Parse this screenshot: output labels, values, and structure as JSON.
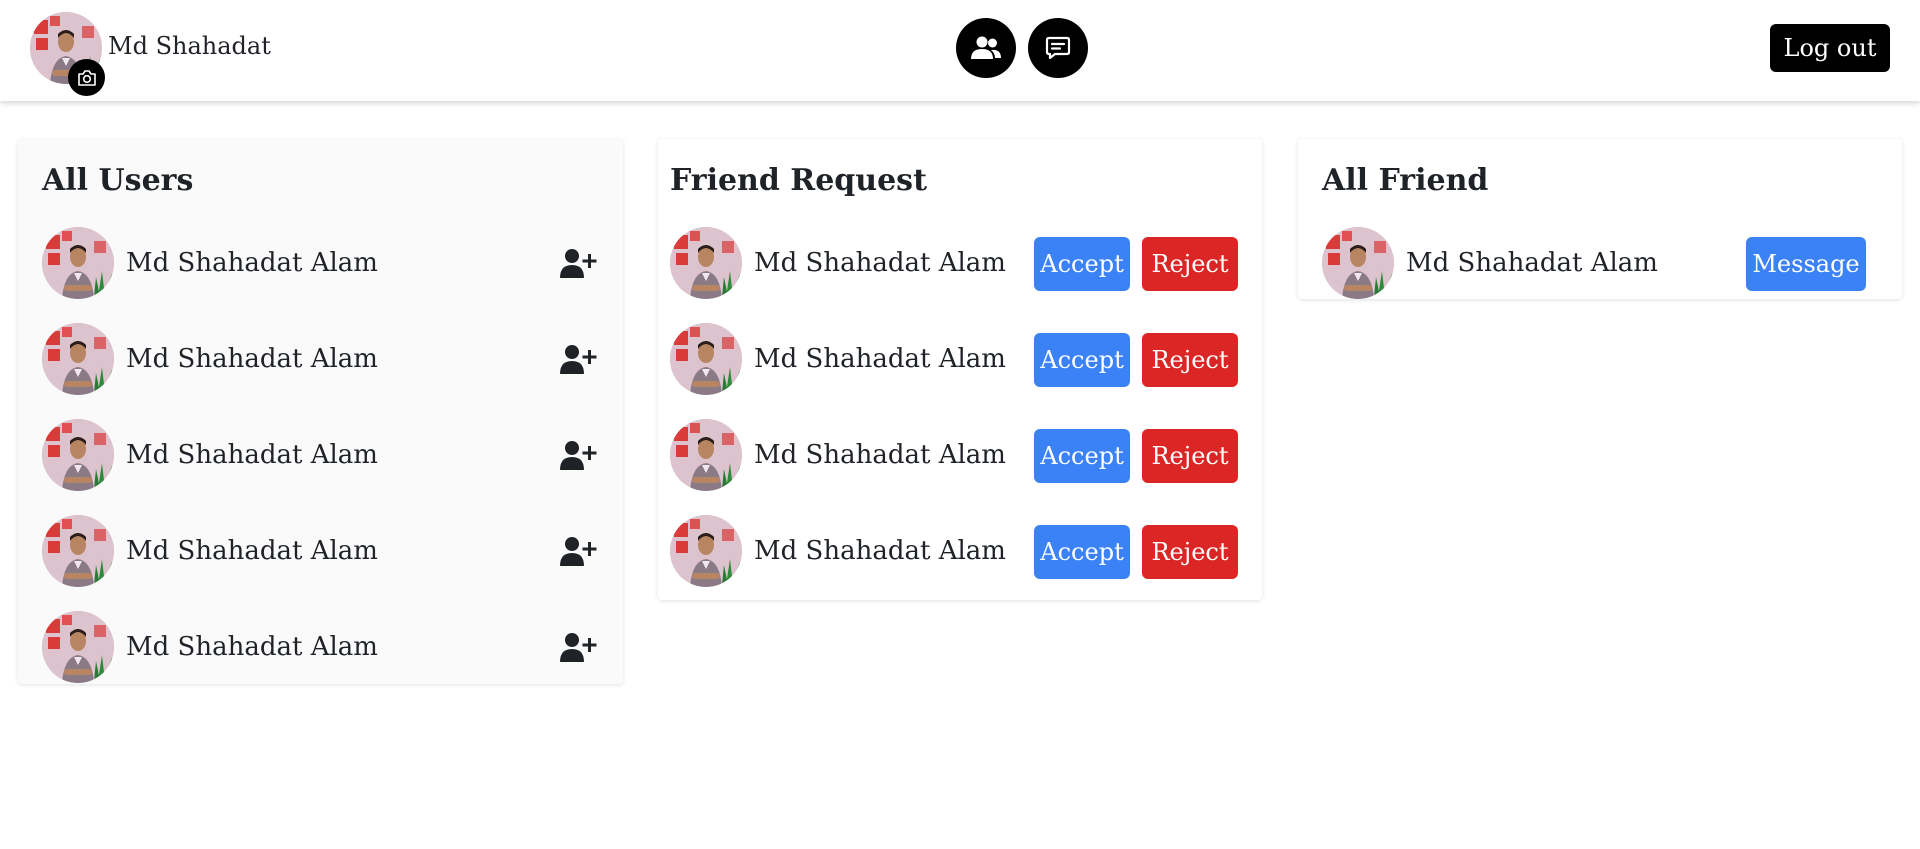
{
  "header": {
    "user_name": "Md Shahadat",
    "logout_label": "Log out",
    "icons": {
      "camera": "camera-icon",
      "friends": "users-icon",
      "messages": "chat-icon"
    }
  },
  "all_users": {
    "title": "All Users",
    "items": [
      {
        "name": "Md Shahadat Alam"
      },
      {
        "name": "Md Shahadat Alam"
      },
      {
        "name": "Md Shahadat Alam"
      },
      {
        "name": "Md Shahadat Alam"
      },
      {
        "name": "Md Shahadat Alam"
      }
    ]
  },
  "friend_requests": {
    "title": "Friend Request",
    "accept_label": "Accept",
    "reject_label": "Reject",
    "items": [
      {
        "name": "Md Shahadat Alam"
      },
      {
        "name": "Md Shahadat Alam"
      },
      {
        "name": "Md Shahadat Alam"
      },
      {
        "name": "Md Shahadat Alam"
      }
    ]
  },
  "all_friends": {
    "title": "All Friend",
    "message_label": "Message",
    "items": [
      {
        "name": "Md Shahadat Alam"
      }
    ]
  },
  "colors": {
    "accept": "#3b82f6",
    "reject": "#dc2626",
    "message": "#3b82f6",
    "header_buttons": "#000000"
  }
}
